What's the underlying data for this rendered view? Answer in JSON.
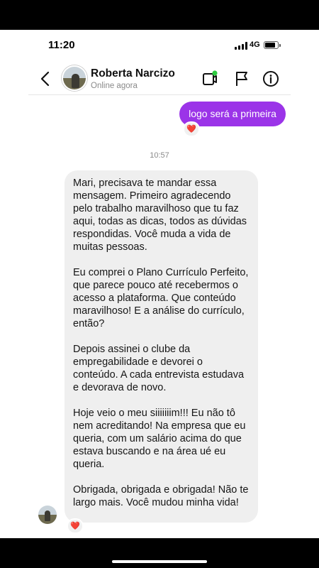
{
  "status_bar": {
    "time": "11:20",
    "network": "4G"
  },
  "header": {
    "contact_name": "Roberta Narcizo",
    "contact_status": "Online agora",
    "icons": [
      "back-chevron-icon",
      "video-call-icon",
      "flag-icon",
      "info-icon"
    ],
    "online_indicator_color": "#2ecc40"
  },
  "messages": {
    "outgoing": {
      "text": "logo será a primeira",
      "reaction": "❤️",
      "bubble_color": "#9b34e8"
    },
    "timestamp": "10:57",
    "incoming": {
      "paragraphs": [
        "Mari, precisava te mandar essa mensagem. Primeiro agradecendo pelo trabalho maravilhoso que tu faz aqui, todas as dicas, todos as dúvidas respondidas. Você muda a vida de muitas pessoas.",
        "Eu comprei o Plano Currículo Perfeito, que parece pouco  até recebermos o acesso a plataforma. Que conteúdo maravilhoso! E a análise do currículo, então?",
        "Depois assinei o clube da empregabilidade e devorei o conteúdo. A cada entrevista estudava e devorava de novo.",
        "Hoje veio o meu siiiiiiim!!! Eu não tô nem acreditando! Na empresa que eu queria, com um salário acima do que estava buscando e na área ué eu queria.",
        "Obrigada, obrigada e obrigada! Não te largo mais. Você mudou minha vida!"
      ],
      "reaction": "❤️",
      "bubble_color": "#efefef"
    }
  }
}
